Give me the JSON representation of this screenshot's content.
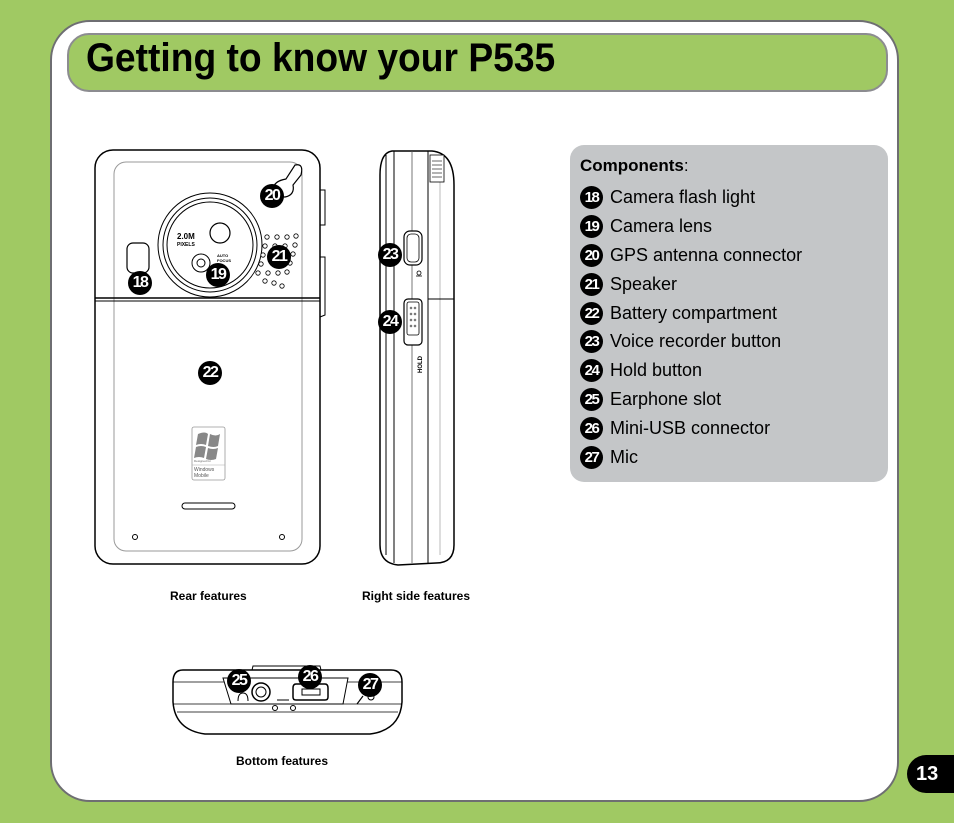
{
  "page": {
    "title": "Getting to know your P535",
    "page_number": "13"
  },
  "components": {
    "heading": "Components",
    "heading_suffix": ":",
    "items": [
      {
        "number": "18",
        "label": "Camera flash light"
      },
      {
        "number": "19",
        "label": "Camera lens"
      },
      {
        "number": "20",
        "label": "GPS antenna connector"
      },
      {
        "number": "21",
        "label": "Speaker"
      },
      {
        "number": "22",
        "label": "Battery compartment"
      },
      {
        "number": "23",
        "label": "Voice recorder button"
      },
      {
        "number": "24",
        "label": "Hold button"
      },
      {
        "number": "25",
        "label": "Earphone slot"
      },
      {
        "number": "26",
        "label": "Mini-USB connector"
      },
      {
        "number": "27",
        "label": "Mic"
      }
    ]
  },
  "figures": {
    "rear": {
      "caption": "Rear features",
      "camera_text_1": "2.0M",
      "camera_text_2": "PIXELS",
      "autofocus_text_1": "AUTO",
      "autofocus_text_2": "FOCUS",
      "logo_text_1": "Designed for",
      "logo_text_2": "Windows",
      "logo_text_3": "Mobile"
    },
    "side": {
      "caption": "Right side features",
      "hold_label": "HOLD"
    },
    "bottom": {
      "caption": "Bottom features"
    }
  }
}
